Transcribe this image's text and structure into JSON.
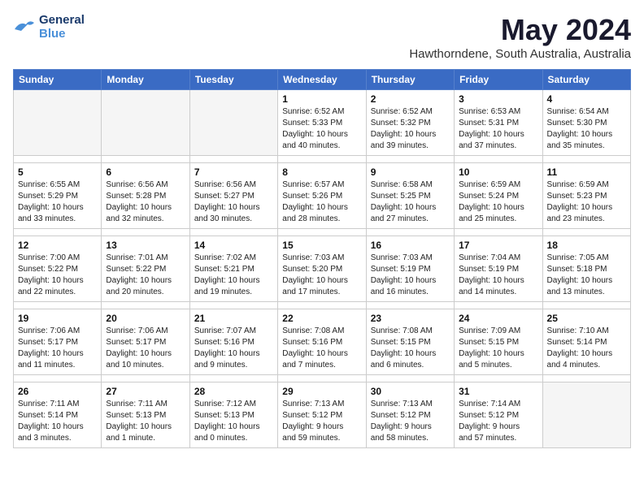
{
  "logo": {
    "line1": "General",
    "line2": "Blue"
  },
  "title": "May 2024",
  "location": "Hawthorndene, South Australia, Australia",
  "headers": [
    "Sunday",
    "Monday",
    "Tuesday",
    "Wednesday",
    "Thursday",
    "Friday",
    "Saturday"
  ],
  "weeks": [
    [
      {
        "num": "",
        "info": ""
      },
      {
        "num": "",
        "info": ""
      },
      {
        "num": "",
        "info": ""
      },
      {
        "num": "1",
        "info": "Sunrise: 6:52 AM\nSunset: 5:33 PM\nDaylight: 10 hours\nand 40 minutes."
      },
      {
        "num": "2",
        "info": "Sunrise: 6:52 AM\nSunset: 5:32 PM\nDaylight: 10 hours\nand 39 minutes."
      },
      {
        "num": "3",
        "info": "Sunrise: 6:53 AM\nSunset: 5:31 PM\nDaylight: 10 hours\nand 37 minutes."
      },
      {
        "num": "4",
        "info": "Sunrise: 6:54 AM\nSunset: 5:30 PM\nDaylight: 10 hours\nand 35 minutes."
      }
    ],
    [
      {
        "num": "5",
        "info": "Sunrise: 6:55 AM\nSunset: 5:29 PM\nDaylight: 10 hours\nand 33 minutes."
      },
      {
        "num": "6",
        "info": "Sunrise: 6:56 AM\nSunset: 5:28 PM\nDaylight: 10 hours\nand 32 minutes."
      },
      {
        "num": "7",
        "info": "Sunrise: 6:56 AM\nSunset: 5:27 PM\nDaylight: 10 hours\nand 30 minutes."
      },
      {
        "num": "8",
        "info": "Sunrise: 6:57 AM\nSunset: 5:26 PM\nDaylight: 10 hours\nand 28 minutes."
      },
      {
        "num": "9",
        "info": "Sunrise: 6:58 AM\nSunset: 5:25 PM\nDaylight: 10 hours\nand 27 minutes."
      },
      {
        "num": "10",
        "info": "Sunrise: 6:59 AM\nSunset: 5:24 PM\nDaylight: 10 hours\nand 25 minutes."
      },
      {
        "num": "11",
        "info": "Sunrise: 6:59 AM\nSunset: 5:23 PM\nDaylight: 10 hours\nand 23 minutes."
      }
    ],
    [
      {
        "num": "12",
        "info": "Sunrise: 7:00 AM\nSunset: 5:22 PM\nDaylight: 10 hours\nand 22 minutes."
      },
      {
        "num": "13",
        "info": "Sunrise: 7:01 AM\nSunset: 5:22 PM\nDaylight: 10 hours\nand 20 minutes."
      },
      {
        "num": "14",
        "info": "Sunrise: 7:02 AM\nSunset: 5:21 PM\nDaylight: 10 hours\nand 19 minutes."
      },
      {
        "num": "15",
        "info": "Sunrise: 7:03 AM\nSunset: 5:20 PM\nDaylight: 10 hours\nand 17 minutes."
      },
      {
        "num": "16",
        "info": "Sunrise: 7:03 AM\nSunset: 5:19 PM\nDaylight: 10 hours\nand 16 minutes."
      },
      {
        "num": "17",
        "info": "Sunrise: 7:04 AM\nSunset: 5:19 PM\nDaylight: 10 hours\nand 14 minutes."
      },
      {
        "num": "18",
        "info": "Sunrise: 7:05 AM\nSunset: 5:18 PM\nDaylight: 10 hours\nand 13 minutes."
      }
    ],
    [
      {
        "num": "19",
        "info": "Sunrise: 7:06 AM\nSunset: 5:17 PM\nDaylight: 10 hours\nand 11 minutes."
      },
      {
        "num": "20",
        "info": "Sunrise: 7:06 AM\nSunset: 5:17 PM\nDaylight: 10 hours\nand 10 minutes."
      },
      {
        "num": "21",
        "info": "Sunrise: 7:07 AM\nSunset: 5:16 PM\nDaylight: 10 hours\nand 9 minutes."
      },
      {
        "num": "22",
        "info": "Sunrise: 7:08 AM\nSunset: 5:16 PM\nDaylight: 10 hours\nand 7 minutes."
      },
      {
        "num": "23",
        "info": "Sunrise: 7:08 AM\nSunset: 5:15 PM\nDaylight: 10 hours\nand 6 minutes."
      },
      {
        "num": "24",
        "info": "Sunrise: 7:09 AM\nSunset: 5:15 PM\nDaylight: 10 hours\nand 5 minutes."
      },
      {
        "num": "25",
        "info": "Sunrise: 7:10 AM\nSunset: 5:14 PM\nDaylight: 10 hours\nand 4 minutes."
      }
    ],
    [
      {
        "num": "26",
        "info": "Sunrise: 7:11 AM\nSunset: 5:14 PM\nDaylight: 10 hours\nand 3 minutes."
      },
      {
        "num": "27",
        "info": "Sunrise: 7:11 AM\nSunset: 5:13 PM\nDaylight: 10 hours\nand 1 minute."
      },
      {
        "num": "28",
        "info": "Sunrise: 7:12 AM\nSunset: 5:13 PM\nDaylight: 10 hours\nand 0 minutes."
      },
      {
        "num": "29",
        "info": "Sunrise: 7:13 AM\nSunset: 5:12 PM\nDaylight: 9 hours\nand 59 minutes."
      },
      {
        "num": "30",
        "info": "Sunrise: 7:13 AM\nSunset: 5:12 PM\nDaylight: 9 hours\nand 58 minutes."
      },
      {
        "num": "31",
        "info": "Sunrise: 7:14 AM\nSunset: 5:12 PM\nDaylight: 9 hours\nand 57 minutes."
      },
      {
        "num": "",
        "info": ""
      }
    ]
  ]
}
